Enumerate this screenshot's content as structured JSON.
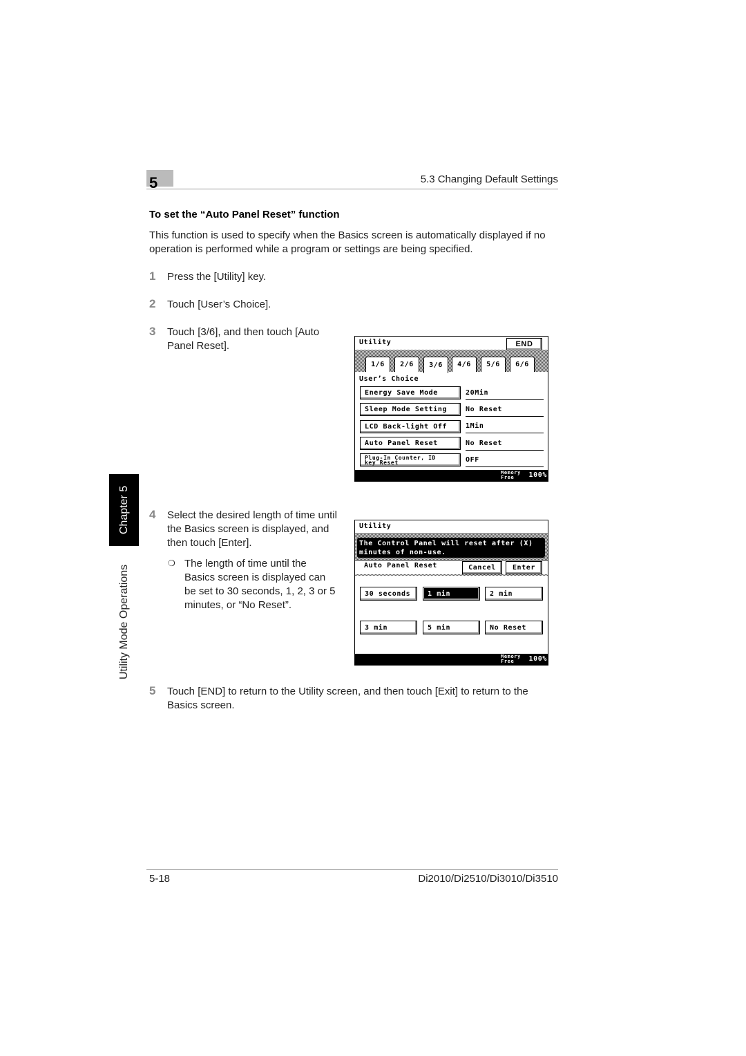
{
  "header": {
    "chapter_number": "5",
    "section": "5.3 Changing Default Settings"
  },
  "side_tab": {
    "chapter": "Chapter 5",
    "section": "Utility Mode Operations"
  },
  "heading": "To set the “Auto Panel Reset” function",
  "intro": "This function is used to specify when the Basics screen is automatically displayed if no operation is performed while a program or settings are being specified.",
  "steps": [
    {
      "n": "1",
      "text": "Press the [Utility] key."
    },
    {
      "n": "2",
      "text": "Touch [User’s Choice]."
    },
    {
      "n": "3",
      "text": "Touch [3/6], and then touch [Auto Panel Reset]."
    },
    {
      "n": "4",
      "text": "Select the desired length of time until the Basics screen is displayed, and then touch [Enter].",
      "note_bullet": "❍",
      "note": "The length of time until the Basics screen is displayed can be set to 30 seconds, 1, 2, 3 or 5 minutes, or “No Reset”."
    },
    {
      "n": "5",
      "text": "Touch [END] to return to the Utility screen, and then touch [Exit] to return to the Basics screen."
    }
  ],
  "screen1": {
    "title": "Utility",
    "end_button": "END",
    "tabs": [
      "1/6",
      "2/6",
      "3/6",
      "4/6",
      "5/6",
      "6/6"
    ],
    "active_tab": "3/6",
    "subtitle": "User’s Choice",
    "rows": [
      {
        "label": "Energy Save Mode",
        "value": "20Min"
      },
      {
        "label": "Sleep Mode Setting",
        "value": "No Reset"
      },
      {
        "label": "LCD Back-light Off",
        "value": "1Min"
      },
      {
        "label": "Auto Panel Reset",
        "value": "No Reset"
      },
      {
        "label": "Plug-In Counter, ID key Reset",
        "value": "OFF"
      }
    ],
    "memory_label": "Memory Free",
    "memory_value": "100%"
  },
  "screen2": {
    "title": "Utility",
    "message": "The Control Panel will reset after (X) minutes of non-use.",
    "subtitle": "Auto Panel Reset",
    "cancel": "Cancel",
    "enter": "Enter",
    "options": [
      "30 seconds",
      "1 min",
      "2 min",
      "3 min",
      "5 min",
      "No Reset"
    ],
    "selected": "1 min",
    "memory_label": "Memory Free",
    "memory_value": "100%"
  },
  "footer": {
    "page": "5-18",
    "model": "Di2010/Di2510/Di3010/Di3510"
  }
}
